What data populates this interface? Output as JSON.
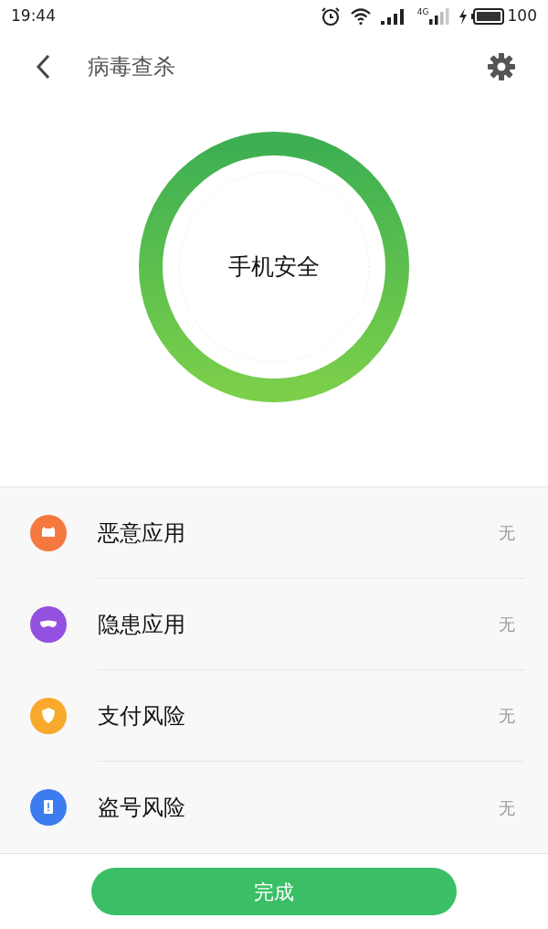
{
  "status_bar": {
    "time": "19:44",
    "network_label": "4G",
    "battery": "100"
  },
  "header": {
    "title": "病毒查杀"
  },
  "scan_ring": {
    "status": "手机安全"
  },
  "risks": [
    {
      "kind": "malware",
      "label": "恶意应用",
      "result": "无",
      "color": "#f5793f"
    },
    {
      "kind": "mask",
      "label": "隐患应用",
      "result": "无",
      "color": "#9450e0"
    },
    {
      "kind": "payment",
      "label": "支付风险",
      "result": "无",
      "color": "#f8a82a"
    },
    {
      "kind": "account",
      "label": "盗号风险",
      "result": "无",
      "color": "#3c7cf0"
    }
  ],
  "done_button": {
    "label": "完成"
  }
}
